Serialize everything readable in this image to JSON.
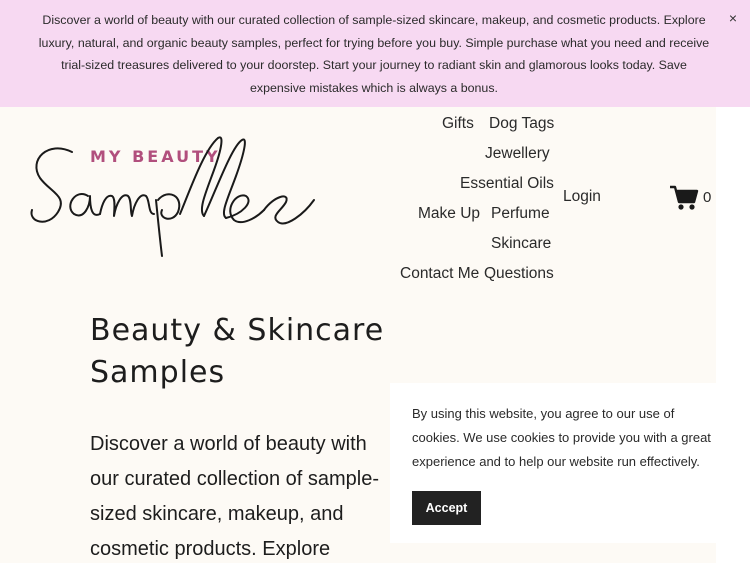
{
  "announcement": {
    "text": "Discover a world of beauty with our curated collection of sample-sized skincare, makeup, and cosmetic products. Explore luxury, natural, and organic beauty samples, perfect for trying before you buy. Simple purchase what you need and receive trial-sized treasures delivered to your doorstep. Start your journey to radiant skin and glamorous looks today. Save expensive mistakes which is always a bonus.",
    "close": "×"
  },
  "logo": {
    "top_text": "MY BEAUTY",
    "script_text": "Samples"
  },
  "nav": {
    "items": [
      "Gifts",
      "Dog Tags",
      "Jewellery",
      "Essential Oils",
      "Make Up",
      "Perfume",
      "Skincare",
      "Contact Me",
      "Questions"
    ],
    "login": "Login",
    "cart_count": "0"
  },
  "hero": {
    "title": "Beauty & Skincare Samples",
    "text": "Discover a world of beauty with our curated collection of sample-sized skincare, makeup, and cosmetic products. Explore"
  },
  "cookie": {
    "text": "By using this website, you agree to our use of cookies. We use cookies to provide you with a great experience and to help our website run effectively.",
    "accept": "Accept"
  },
  "colors": {
    "announce_bg": "#f7d9f2",
    "page_bg": "#fdfaf5",
    "brand": "#b14f7d"
  },
  "icons": {
    "cart": "shopping-cart-icon",
    "close": "close-icon"
  }
}
